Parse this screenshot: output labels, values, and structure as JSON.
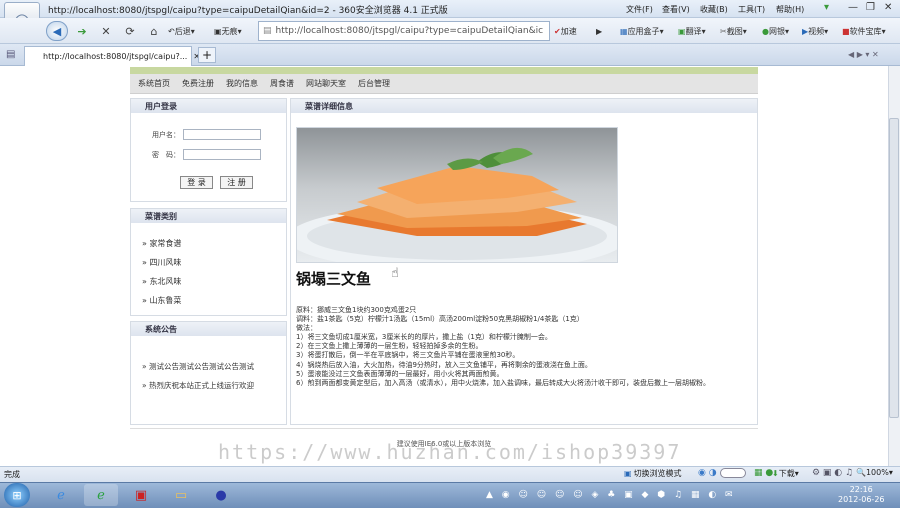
{
  "browser": {
    "title": "http://localhost:8080/jtspgl/caipu?type=caipuDetailQian&id=2 - 360安全浏览器 4.1 正式版",
    "menus": [
      "文件(F)",
      "查看(V)",
      "收藏(B)",
      "工具(T)",
      "帮助(H)"
    ],
    "back_label": "后退",
    "hide_label": "无痕",
    "address": "http://localhost:8080/jtspgl/caipu?type=caipuDetailQian&ic",
    "accelerate_label": "加速",
    "toolbar": [
      "应用盒子",
      "翻译",
      "截图",
      "网银",
      "视频",
      "软件宝库"
    ],
    "tab_title": "http://localhost:8080/jtspgl/caipu?...",
    "status": "完成",
    "status_right": [
      "切换浏览模式",
      "下载",
      "100%"
    ]
  },
  "site": {
    "nav": [
      "系统首页",
      "免费注册",
      "我的信息",
      "周食谱",
      "网站聊天室",
      "后台管理"
    ],
    "login": {
      "title": "用户登录",
      "username_label": "用户名：",
      "password_label": "密　码：",
      "login_btn": "登 录",
      "register_btn": "注 册"
    },
    "category": {
      "title": "菜谱类别",
      "items": [
        "家常食谱",
        "四川风味",
        "东北风味",
        "山东鲁菜"
      ]
    },
    "notice": {
      "title": "系统公告",
      "items": [
        "测试公告测试公告测试公告测试",
        "热烈庆祝本站正式上线运行欢迎"
      ]
    },
    "detail": {
      "title": "菜谱详细信息",
      "recipe_name": "锅塌三文鱼",
      "lines": [
        "原料：挪威三文鱼1块约300克鸡蛋2只",
        "调料：盐1茶匙（5克）柠檬汁1汤匙（15ml）高汤200ml淀粉50克黑胡椒粉1/4茶匙（1克）",
        "做法：",
        "1）将三文鱼切成1厘米宽，3厘米长的的厚片，撒上盐（1克）和柠檬汁腌制一会。",
        "2）在三文鱼上撒上薄薄的一层生粉，轻轻拍掉多余的生粉。",
        "3）将蛋打散后，倒一半在平底锅中，将三文鱼片平铺在蛋液里煎30秒。",
        "4）锅烧热后放入油，大火加热，待油9分热时，放入三文鱼铺平，再将剩余的蛋液浇在鱼上面。",
        "5）蛋液能没过三文鱼表面薄薄的一层最好，用小火将其两面煎黄。",
        "6）煎到两面都变黄定型后，加入高汤（或清水），用中火烧沸，加入盐调味，最后转成大火将汤汁收干即可，装盘后撒上一层胡椒粉。"
      ]
    },
    "footer": "建议使用IE6.0或以上版本浏览",
    "watermark": "https://www.huzhan.com/ishop39397"
  },
  "taskbar": {
    "time": "22:16",
    "date": "2012-06-26"
  }
}
